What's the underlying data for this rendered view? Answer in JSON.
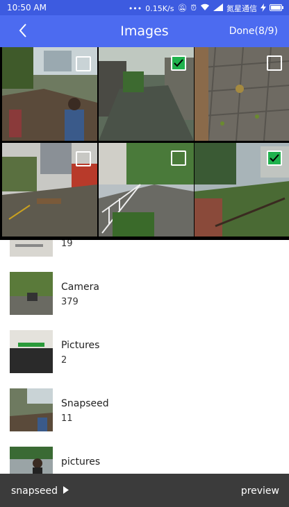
{
  "status_bar": {
    "time": "10:50 AM",
    "net_speed": "0.15K/s",
    "carrier": "氮星通信"
  },
  "header": {
    "title": "Images",
    "done_label": "Done(8/9)"
  },
  "grid": {
    "checked": [
      false,
      true,
      false,
      false,
      false,
      true
    ]
  },
  "albums": [
    {
      "name": "",
      "count": "19"
    },
    {
      "name": "Camera",
      "count": "379"
    },
    {
      "name": "Pictures",
      "count": "2"
    },
    {
      "name": "Snapseed",
      "count": "11"
    },
    {
      "name": "pictures",
      "count": ""
    }
  ],
  "bottom_bar": {
    "folder_label": "snapseed",
    "preview_label": "preview"
  },
  "colors": {
    "status_bar": "#3d5be0",
    "app_bar": "#4c6bf0",
    "check_on": "#1fb24d",
    "bottom_bar": "#3b3b3b"
  }
}
